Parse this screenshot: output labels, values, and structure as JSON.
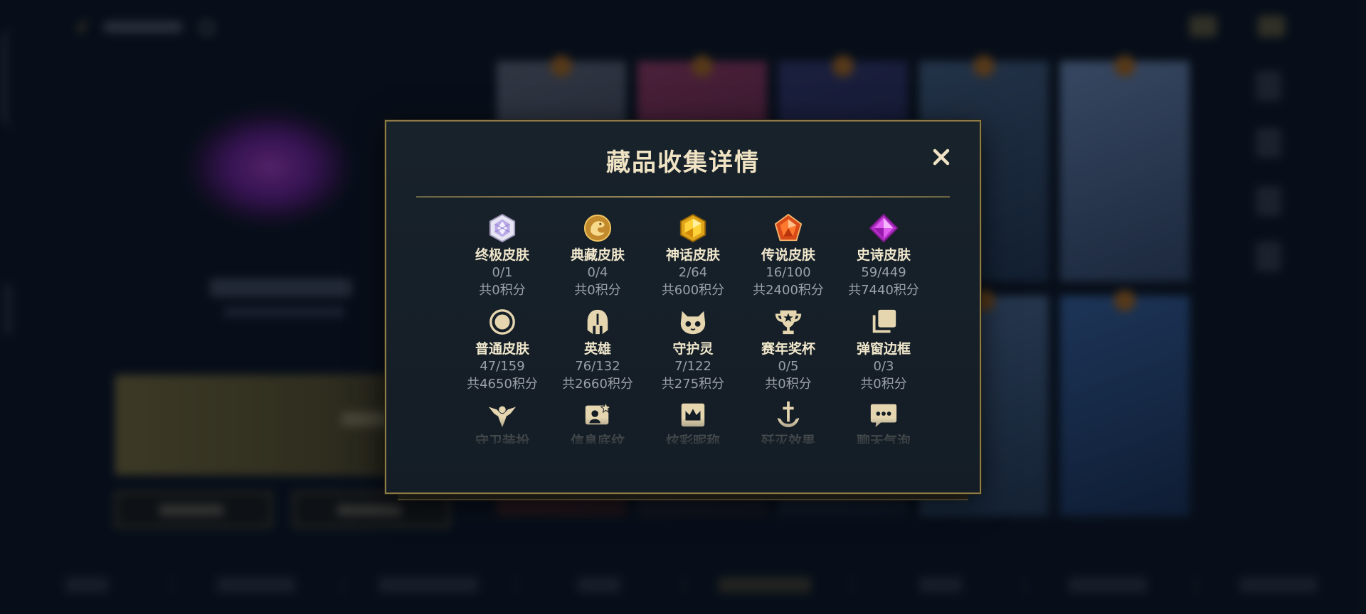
{
  "modal": {
    "title": "藏品收集详情",
    "close_label": "✕"
  },
  "colors": {
    "accent_gold": "#c9a85a",
    "icon_gold": "#e5d6b0",
    "text_primary": "#f0e7cc",
    "text_secondary": "#9aa0a8",
    "modal_border": "#8e7a45"
  },
  "categories_row1": [
    {
      "name": "终极皮肤",
      "count": "0/1",
      "points": "共0积分",
      "icon": "ultimate-gem-icon"
    },
    {
      "name": "典藏皮肤",
      "count": "0/4",
      "points": "共0积分",
      "icon": "dragon-emblem-icon"
    },
    {
      "name": "神话皮肤",
      "count": "2/64",
      "points": "共600积分",
      "icon": "mythic-gem-icon"
    },
    {
      "name": "传说皮肤",
      "count": "16/100",
      "points": "共2400积分",
      "icon": "legendary-gem-icon"
    },
    {
      "name": "史诗皮肤",
      "count": "59/449",
      "points": "共7440积分",
      "icon": "epic-gem-icon"
    }
  ],
  "categories_row2": [
    {
      "name": "普通皮肤",
      "count": "47/159",
      "points": "共4650积分",
      "icon": "ring-icon"
    },
    {
      "name": "英雄",
      "count": "76/132",
      "points": "共2660积分",
      "icon": "helmet-icon"
    },
    {
      "name": "守护灵",
      "count": "7/122",
      "points": "共275积分",
      "icon": "little-legend-icon"
    },
    {
      "name": "赛年奖杯",
      "count": "0/5",
      "points": "共0积分",
      "icon": "trophy-icon"
    },
    {
      "name": "弹窗边框",
      "count": "0/3",
      "points": "共0积分",
      "icon": "stacked-frames-icon"
    }
  ],
  "categories_row3": [
    {
      "name": "守卫装扮",
      "icon": "ward-icon"
    },
    {
      "name": "信息底纹",
      "icon": "profile-banner-icon"
    },
    {
      "name": "炫彩昵称",
      "icon": "crown-card-icon"
    },
    {
      "name": "歼灭效果",
      "icon": "anchor-sword-icon"
    },
    {
      "name": "聊天气泡",
      "icon": "chat-bubble-icon"
    }
  ]
}
